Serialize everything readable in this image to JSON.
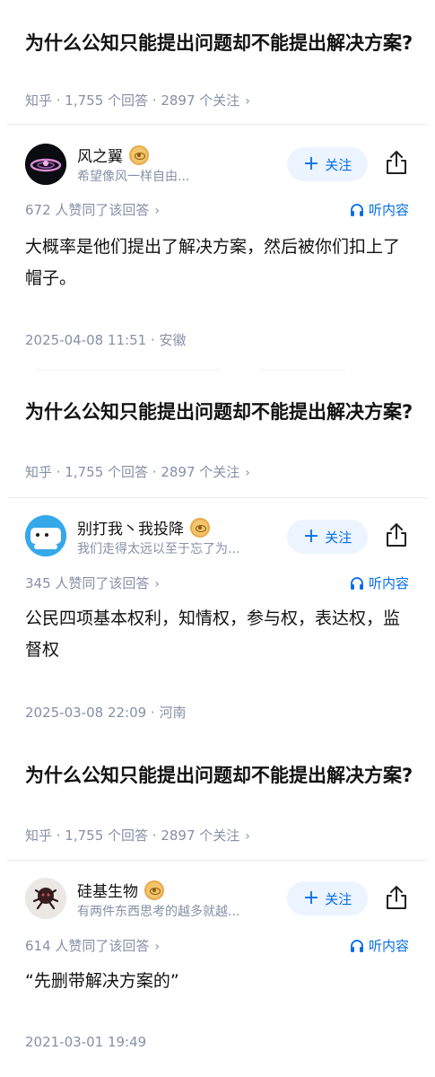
{
  "cards": [
    {
      "question_title": "为什么公知只能提出问题却不能提出解决方案?",
      "question_meta": "知乎 · 1,755 个回答 · 2897 个关注",
      "author_name": "风之翼",
      "author_bio": "希望像风一样自由...",
      "follow_label": "关注",
      "votes": "672 人赞同了该回答",
      "listen_label": "听内容",
      "answer_text": "大概率是他们提出了解决方案，然后被你们扣上了帽子。",
      "footer": "2025-04-08 11:51 · 安徽"
    },
    {
      "question_title": "为什么公知只能提出问题却不能提出解决方案?",
      "question_meta": "知乎 · 1,755 个回答 · 2897 个关注",
      "author_name": "别打我丶我投降",
      "author_bio": "我们走得太远以至于忘了为...",
      "follow_label": "关注",
      "votes": "345 人赞同了该回答",
      "listen_label": "听内容",
      "answer_text": "公民四项基本权利，知情权，参与权，表达权，监督权",
      "footer": "2025-03-08 22:09 · 河南"
    },
    {
      "question_title": "为什么公知只能提出问题却不能提出解决方案?",
      "question_meta": "知乎 · 1,755 个回答 · 2897 个关注",
      "author_name": "硅基生物",
      "author_bio": "有两件东西思考的越多就越...",
      "follow_label": "关注",
      "votes": "614 人赞同了该回答",
      "listen_label": "听内容",
      "answer_text": "“先删带解决方案的”",
      "footer": "2021-03-01 19:49"
    }
  ],
  "icons": {
    "follow": "plus-icon",
    "share": "share-icon",
    "listen": "headphones-icon",
    "chevron": "chevron-right-icon",
    "badge": "eye-badge-icon"
  },
  "colors": {
    "accent": "#056de8",
    "follow_bg": "#ebf4ff",
    "meta": "#8590a6",
    "text": "#121212"
  }
}
